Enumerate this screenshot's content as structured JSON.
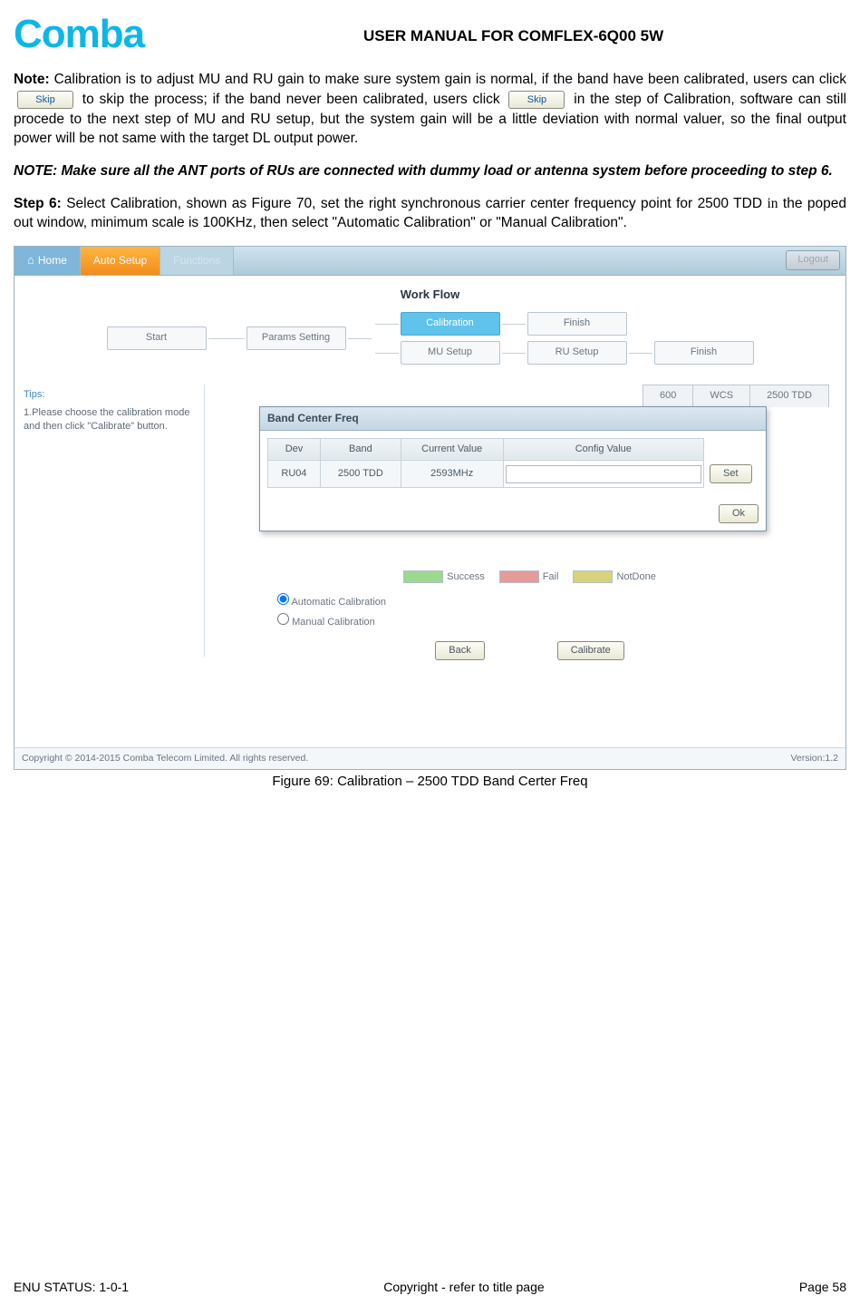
{
  "header": {
    "logo_text": "Comba",
    "manual_title": "USER MANUAL FOR COMFLEX-6Q00 5W"
  },
  "note_paragraph": {
    "prefix_bold": "Note:",
    "part1": " Calibration is to adjust MU and RU gain to make sure system gain is normal, if the band have been calibrated, users can click ",
    "skip1": "Skip",
    "part2": " to skip the process; if the band never been calibrated, users click ",
    "skip2": "Skip",
    "part3": " in the step of Calibration, software can still procede to the next step of MU and RU setup, but the system gain will be a little deviation with normal valuer, so the final output power will be not same with the target DL output power."
  },
  "note_italic": "NOTE: Make sure all the ANT ports of RUs are connected with dummy load or antenna system before proceeding to step 6.",
  "step6": {
    "prefix_bold": "Step 6:",
    "body_a": " Select Calibration, shown as Figure 70, set the right synchronous carrier center frequency point for 2500 TDD ",
    "body_in": "in",
    "body_b": " the poped out window, minimum scale is 100KHz, then select \"Automatic Calibration\" or \"Manual Calibration\"."
  },
  "screenshot": {
    "nav": {
      "home": "Home",
      "auto": "Auto Setup",
      "functions": "Functions",
      "logout": "Logout"
    },
    "workflow_title": "Work Flow",
    "workflow": {
      "start": "Start",
      "params": "Params Setting",
      "calibration": "Calibration",
      "mu": "MU Setup",
      "finish_top": "Finish",
      "ru": "RU Setup",
      "finish_bottom": "Finish"
    },
    "tips_title": "Tips:",
    "tips_body": "1.Please choose the calibration mode and then click \"Calibrate\" button.",
    "band_tabs": [
      "600",
      "WCS",
      "2500 TDD"
    ],
    "modal": {
      "title": "Band Center Freq",
      "cols": {
        "dev": "Dev",
        "band": "Band",
        "current": "Current Value",
        "config": "Config Value"
      },
      "row": {
        "dev": "RU04",
        "band": "2500 TDD",
        "current": "2593MHz",
        "config_placeholder": ""
      },
      "set_btn": "Set",
      "ok_btn": "Ok"
    },
    "legend": {
      "success": "Success",
      "fail": "Fail",
      "notdone": "NotDone"
    },
    "radios": {
      "auto": "Automatic Calibration",
      "manual": "Manual Calibration"
    },
    "buttons": {
      "back": "Back",
      "calibrate": "Calibrate"
    },
    "footer": {
      "copyright": "Copyright © 2014-2015 Comba Telecom Limited. All rights reserved.",
      "version": "Version:1.2"
    }
  },
  "figure_caption": "Figure 69: Calibration – 2500 TDD Band Certer Freq",
  "page_footer": {
    "left": "ENU STATUS: 1-0-1",
    "center": "Copyright - refer to title page",
    "right": "Page 58"
  }
}
